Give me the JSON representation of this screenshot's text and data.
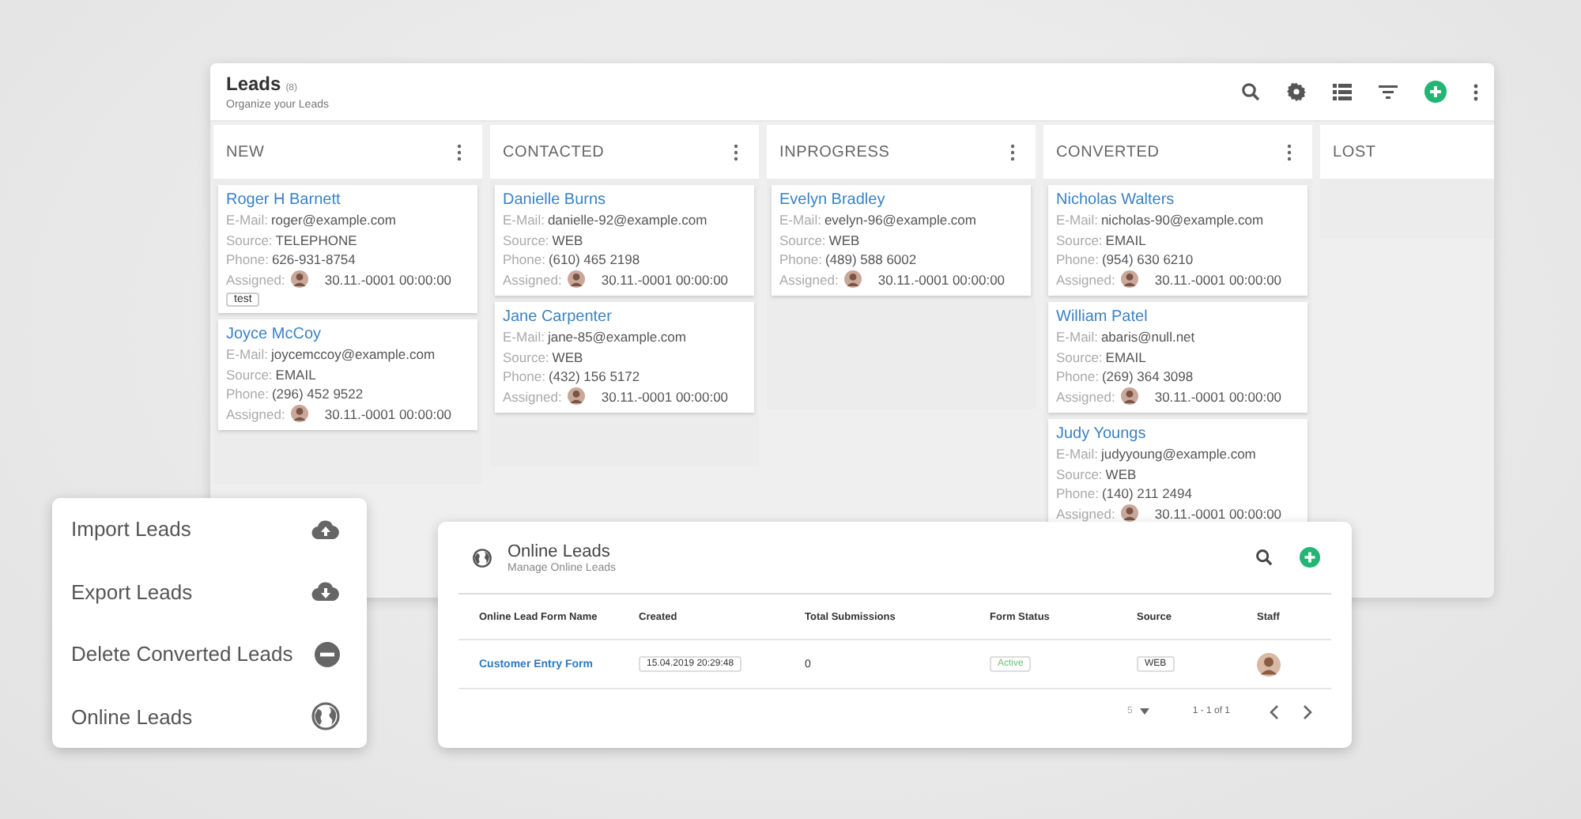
{
  "board": {
    "title": "Leads",
    "count": "(8)",
    "subtitle": "Organize your Leads",
    "columns": [
      {
        "title": "NEW",
        "has_menu": true,
        "leads": [
          {
            "name": "Roger H Barnett",
            "fields": [
              {
                "label": "E-Mail:",
                "value": "roger@example.com"
              },
              {
                "label": "Source:",
                "value": "TELEPHONE"
              },
              {
                "label": "Phone:",
                "value": "626-931-8754"
              }
            ],
            "assigned_label": "Assigned:",
            "date": "30.11.-0001 00:00:00",
            "tag": "test"
          },
          {
            "name": "Joyce McCoy",
            "fields": [
              {
                "label": "E-Mail:",
                "value": "joycemccoy@example.com"
              },
              {
                "label": "Source:",
                "value": "EMAIL"
              },
              {
                "label": "Phone:",
                "value": "(296) 452 9522"
              }
            ],
            "assigned_label": "Assigned:",
            "date": "30.11.-0001 00:00:00"
          }
        ]
      },
      {
        "title": "CONTACTED",
        "has_menu": true,
        "leads": [
          {
            "name": "Danielle Burns",
            "fields": [
              {
                "label": "E-Mail:",
                "value": "danielle-92@example.com"
              },
              {
                "label": "Source:",
                "value": "WEB"
              },
              {
                "label": "Phone:",
                "value": "(610) 465 2198"
              }
            ],
            "assigned_label": "Assigned:",
            "date": "30.11.-0001 00:00:00"
          },
          {
            "name": "Jane Carpenter",
            "fields": [
              {
                "label": "E-Mail:",
                "value": "jane-85@example.com"
              },
              {
                "label": "Source:",
                "value": "WEB"
              },
              {
                "label": "Phone:",
                "value": "(432) 156 5172"
              }
            ],
            "assigned_label": "Assigned:",
            "date": "30.11.-0001 00:00:00"
          }
        ]
      },
      {
        "title": "INPROGRESS",
        "has_menu": true,
        "leads": [
          {
            "name": "Evelyn Bradley",
            "fields": [
              {
                "label": "E-Mail:",
                "value": "evelyn-96@example.com"
              },
              {
                "label": "Source:",
                "value": "WEB"
              },
              {
                "label": "Phone:",
                "value": "(489) 588 6002"
              }
            ],
            "assigned_label": "Assigned:",
            "date": "30.11.-0001 00:00:00"
          }
        ]
      },
      {
        "title": "CONVERTED",
        "has_menu": true,
        "leads": [
          {
            "name": "Nicholas Walters",
            "fields": [
              {
                "label": "E-Mail:",
                "value": "nicholas-90@example.com"
              },
              {
                "label": "Source:",
                "value": "EMAIL"
              },
              {
                "label": "Phone:",
                "value": "(954) 630 6210"
              }
            ],
            "assigned_label": "Assigned:",
            "date": "30.11.-0001 00:00:00"
          },
          {
            "name": "William Patel",
            "fields": [
              {
                "label": "E-Mail:",
                "value": "abaris@null.net"
              },
              {
                "label": "Source:",
                "value": "EMAIL"
              },
              {
                "label": "Phone:",
                "value": "(269) 364 3098"
              }
            ],
            "assigned_label": "Assigned:",
            "date": "30.11.-0001 00:00:00"
          },
          {
            "name": "Judy Youngs",
            "fields": [
              {
                "label": "E-Mail:",
                "value": "judyyoung@example.com"
              },
              {
                "label": "Source:",
                "value": "WEB"
              },
              {
                "label": "Phone:",
                "value": "(140) 211 2494"
              }
            ],
            "assigned_label": "Assigned:",
            "date": "30.11.-0001 00:00:00"
          }
        ]
      },
      {
        "title": "LOST",
        "has_menu": false
      }
    ]
  },
  "menu": {
    "items": [
      {
        "label": "Import Leads"
      },
      {
        "label": "Export Leads"
      },
      {
        "label": "Delete Converted Leads"
      },
      {
        "label": "Online Leads"
      }
    ]
  },
  "online": {
    "title": "Online Leads",
    "subtitle": "Manage Online Leads",
    "columns": [
      "Online Lead Form Name",
      "Created",
      "Total Submissions",
      "Form Status",
      "Source",
      "Staff"
    ],
    "rows": [
      {
        "name": "Customer Entry Form",
        "created": "15.04.2019 20:29:48",
        "submissions": "0",
        "status": "Active",
        "source": "WEB"
      }
    ],
    "per_page": "5",
    "range": "1 - 1 of 1"
  }
}
